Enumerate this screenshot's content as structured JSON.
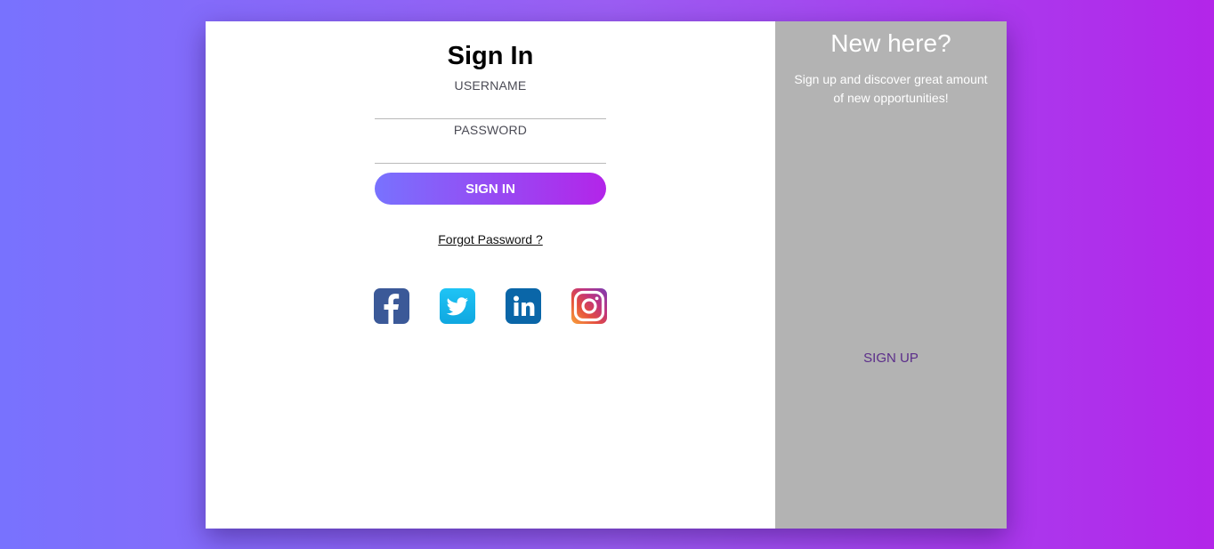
{
  "signin": {
    "title": "Sign In",
    "username_label": "USERNAME",
    "username_value": "",
    "password_label": "PASSWORD",
    "password_value": "",
    "submit_label": "SIGN IN",
    "forgot_label": "Forgot Password ?"
  },
  "social": [
    {
      "name": "facebook-icon",
      "color": "#3b5998"
    },
    {
      "name": "twitter-icon",
      "color": "#1da1f2"
    },
    {
      "name": "linkedin-icon",
      "color": "#0a66a8"
    },
    {
      "name": "instagram-icon",
      "color": "#c13584"
    }
  ],
  "signup": {
    "title": "New here?",
    "text": "Sign up and discover great amount of new opportunities!",
    "button_label": "SIGN UP"
  },
  "colors": {
    "gradient_start": "#7872fe",
    "gradient_end": "#b325e9",
    "panel_gray": "#b3b3b3",
    "signup_link": "#5b2d8a"
  }
}
